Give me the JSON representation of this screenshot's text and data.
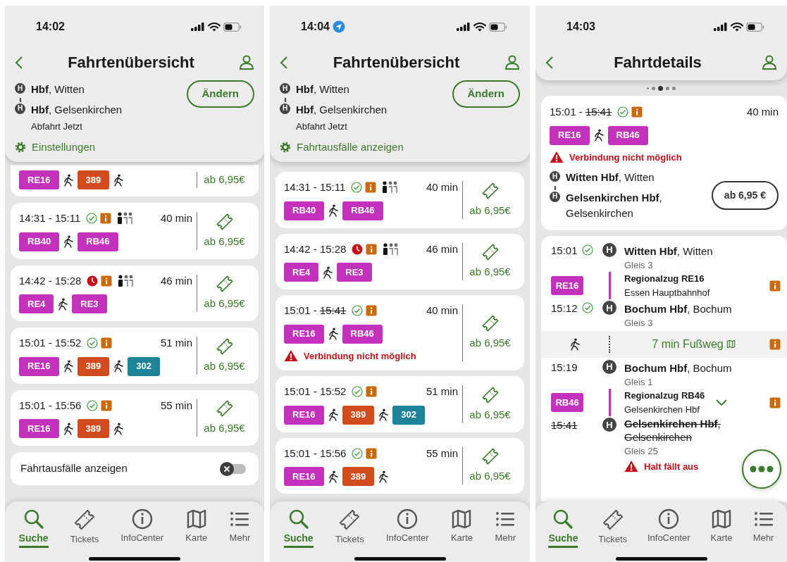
{
  "screens": [
    {
      "kind": "overview",
      "status_bar": {
        "time": "14:02",
        "location": false
      },
      "header": {
        "title": "Fahrtenübersicht",
        "from": {
          "symbol": "H",
          "name": "**Hbf**, Witten"
        },
        "to": {
          "symbol": "H",
          "name": "**Hbf**, Gelsenkirchen"
        },
        "departure": "Abfahrt Jetzt",
        "change_button": "Ändern",
        "link": "Einstellungen"
      },
      "connections": [
        {
          "legs": [
            {
              "kind": "vehicle",
              "label": "RE16",
              "color": "#c431bd"
            },
            {
              "kind": "walk"
            },
            {
              "kind": "vehicle",
              "label": "389",
              "color": "#d24b1d"
            },
            {
              "kind": "walk"
            }
          ],
          "price": "ab 6,95€"
        },
        {
          "departure": "14:31 -",
          "arrival": "15:11",
          "arrival_cancelled": false,
          "delayed": false,
          "info": true,
          "occupancy": true,
          "duration": "40 min",
          "legs": [
            {
              "kind": "vehicle",
              "label": "RB40",
              "color": "#c431bd"
            },
            {
              "kind": "walk"
            },
            {
              "kind": "vehicle",
              "label": "RB46",
              "color": "#c431bd"
            }
          ],
          "price": "ab 6,95€"
        },
        {
          "departure": "14:42 -",
          "arrival": "15:28",
          "arrival_cancelled": false,
          "delayed": true,
          "info": true,
          "occupancy": true,
          "duration": "46 min",
          "legs": [
            {
              "kind": "vehicle",
              "label": "RE4",
              "color": "#c431bd"
            },
            {
              "kind": "walk"
            },
            {
              "kind": "vehicle",
              "label": "RE3",
              "color": "#c431bd"
            }
          ],
          "price": "ab 6,95€"
        },
        {
          "departure": "15:01 -",
          "arrival": "15:52",
          "arrival_cancelled": false,
          "delayed": false,
          "info": true,
          "occupancy": false,
          "duration": "51 min",
          "legs": [
            {
              "kind": "vehicle",
              "label": "RE16",
              "color": "#c431bd"
            },
            {
              "kind": "walk"
            },
            {
              "kind": "vehicle",
              "label": "389",
              "color": "#d24b1d"
            },
            {
              "kind": "walk"
            },
            {
              "kind": "vehicle",
              "label": "302",
              "color": "#1d8399"
            }
          ],
          "price": "ab 6,95€"
        },
        {
          "departure": "15:01 -",
          "arrival": "15:56",
          "arrival_cancelled": false,
          "delayed": false,
          "info": true,
          "occupancy": false,
          "duration": "55 min",
          "legs": [
            {
              "kind": "vehicle",
              "label": "RE16",
              "color": "#c431bd"
            },
            {
              "kind": "walk"
            },
            {
              "kind": "vehicle",
              "label": "389",
              "color": "#d24b1d"
            },
            {
              "kind": "walk"
            }
          ],
          "price": "ab 6,95€"
        }
      ],
      "cancellations_toggle": {
        "label": "Fahrtausfälle anzeigen",
        "on": false
      },
      "nav": [
        {
          "label": "Suche",
          "selected": true
        },
        {
          "label": "Tickets",
          "selected": false
        },
        {
          "label": "InfoCenter",
          "selected": false
        },
        {
          "label": "Karte",
          "selected": false
        },
        {
          "label": "Mehr",
          "selected": false
        }
      ]
    },
    {
      "kind": "overview",
      "status_bar": {
        "time": "14:04",
        "location": true
      },
      "header": {
        "title": "Fahrtenübersicht",
        "from": {
          "symbol": "H",
          "name": "**Hbf**, Witten"
        },
        "to": {
          "symbol": "H",
          "name": "**Hbf**, Gelsenkirchen"
        },
        "departure": "Abfahrt Jetzt",
        "change_button": "Ändern",
        "link": "Fahrtausfälle anzeigen"
      },
      "connections": [
        {
          "departure": "14:31 -",
          "arrival": "15:11",
          "arrival_cancelled": false,
          "delayed": false,
          "info": true,
          "occupancy": true,
          "duration": "40 min",
          "legs": [
            {
              "kind": "vehicle",
              "label": "RB40",
              "color": "#c431bd"
            },
            {
              "kind": "walk"
            },
            {
              "kind": "vehicle",
              "label": "RB46",
              "color": "#c431bd"
            }
          ],
          "price": "ab 6,95€"
        },
        {
          "departure": "14:42 -",
          "arrival": "15:28",
          "arrival_cancelled": false,
          "delayed": true,
          "info": true,
          "occupancy": true,
          "duration": "46 min",
          "legs": [
            {
              "kind": "vehicle",
              "label": "RE4",
              "color": "#c431bd"
            },
            {
              "kind": "walk"
            },
            {
              "kind": "vehicle",
              "label": "RE3",
              "color": "#c431bd"
            }
          ],
          "price": "ab 6,95€"
        },
        {
          "departure": "15:01 -",
          "arrival": "15:41",
          "arrival_cancelled": true,
          "delayed": false,
          "info": true,
          "occupancy": false,
          "duration": "40 min",
          "legs": [
            {
              "kind": "vehicle",
              "label": "RE16",
              "color": "#c431bd"
            },
            {
              "kind": "walk"
            },
            {
              "kind": "vehicle",
              "label": "RB46",
              "color": "#c431bd"
            }
          ],
          "warning": "Verbindung nicht möglich",
          "price": "ab 6,95€"
        },
        {
          "departure": "15:01 -",
          "arrival": "15:52",
          "arrival_cancelled": false,
          "delayed": false,
          "info": true,
          "occupancy": false,
          "duration": "51 min",
          "legs": [
            {
              "kind": "vehicle",
              "label": "RE16",
              "color": "#c431bd"
            },
            {
              "kind": "walk"
            },
            {
              "kind": "vehicle",
              "label": "389",
              "color": "#d24b1d"
            },
            {
              "kind": "walk"
            },
            {
              "kind": "vehicle",
              "label": "302",
              "color": "#1d8399"
            }
          ],
          "price": "ab 6,95€"
        },
        {
          "departure": "15:01 -",
          "arrival": "15:56",
          "arrival_cancelled": false,
          "delayed": false,
          "info": true,
          "occupancy": false,
          "duration": "55 min",
          "legs": [
            {
              "kind": "vehicle",
              "label": "RE16",
              "color": "#c431bd"
            },
            {
              "kind": "walk"
            },
            {
              "kind": "vehicle",
              "label": "389",
              "color": "#d24b1d"
            },
            {
              "kind": "walk"
            }
          ],
          "price": "ab 6,95€"
        }
      ],
      "nav": [
        {
          "label": "Suche",
          "selected": true
        },
        {
          "label": "Tickets",
          "selected": false
        },
        {
          "label": "InfoCenter",
          "selected": false
        },
        {
          "label": "Karte",
          "selected": false
        },
        {
          "label": "Mehr",
          "selected": false
        }
      ]
    },
    {
      "kind": "details",
      "status_bar": {
        "time": "14:03",
        "location": false
      },
      "header": {
        "title": "Fahrtdetails"
      },
      "pager": [
        {
          "selected": false
        },
        {
          "selected": false
        },
        {
          "selected": true
        },
        {
          "selected": false
        },
        {
          "selected": false
        }
      ],
      "summary": {
        "departure": "15:01 -",
        "arrival": "15:41",
        "arrival_cancelled": true,
        "delayed": false,
        "info": true,
        "duration": "40 min",
        "legs": [
          {
            "kind": "vehicle",
            "label": "RE16",
            "color": "#c431bd"
          },
          {
            "kind": "walk"
          },
          {
            "kind": "vehicle",
            "label": "RB46",
            "color": "#c431bd"
          }
        ],
        "warning": "Verbindung nicht möglich",
        "from": {
          "symbol": "H",
          "name": "**Witten Hbf**, Witten"
        },
        "to": {
          "symbol": "H",
          "name": "**Gelsenkirchen Hbf**, Gelsenkirchen"
        },
        "price_button": "ab 6,95 €"
      },
      "timeline": [
        {
          "kind": "stop",
          "time": "15:01",
          "on_time": true,
          "symbol": "H",
          "name": "**Witten Hbf**, Witten",
          "platform": "Gleis 3",
          "cancelled": false
        },
        {
          "kind": "leg",
          "badge": "RE16",
          "color": "#c431bd",
          "title": "Regionalzug RE16",
          "direction": "Essen Hauptbahnhof",
          "info": true,
          "expandable": false
        },
        {
          "kind": "stop",
          "time": "15:12",
          "on_time": true,
          "symbol": "H",
          "name": "**Bochum Hbf**, Bochum",
          "platform": "Gleis 3",
          "cancelled": false
        },
        {
          "kind": "walk",
          "label": "7 min Fußweg",
          "info": true
        },
        {
          "kind": "stop",
          "time": "15:19",
          "on_time": false,
          "symbol": "H",
          "name": "**Bochum Hbf**, Bochum",
          "platform": "Gleis 1",
          "cancelled": false
        },
        {
          "kind": "leg",
          "badge": "RB46",
          "color": "#c431bd",
          "title": "Regionalzug RB46",
          "direction": "Gelsenkirchen Hbf",
          "info": true,
          "expandable": true
        },
        {
          "kind": "stop",
          "time": "15:41",
          "on_time": false,
          "symbol": "H",
          "name": "**Gelsenkirchen Hbf**, Gelsenkirchen",
          "platform": "Gleis 25",
          "cancelled": true,
          "warning": "Halt fällt aus"
        }
      ],
      "nav": [
        {
          "label": "Suche",
          "selected": true
        },
        {
          "label": "Tickets",
          "selected": false
        },
        {
          "label": "InfoCenter",
          "selected": false
        },
        {
          "label": "Karte",
          "selected": false
        },
        {
          "label": "Mehr",
          "selected": false
        }
      ]
    }
  ]
}
